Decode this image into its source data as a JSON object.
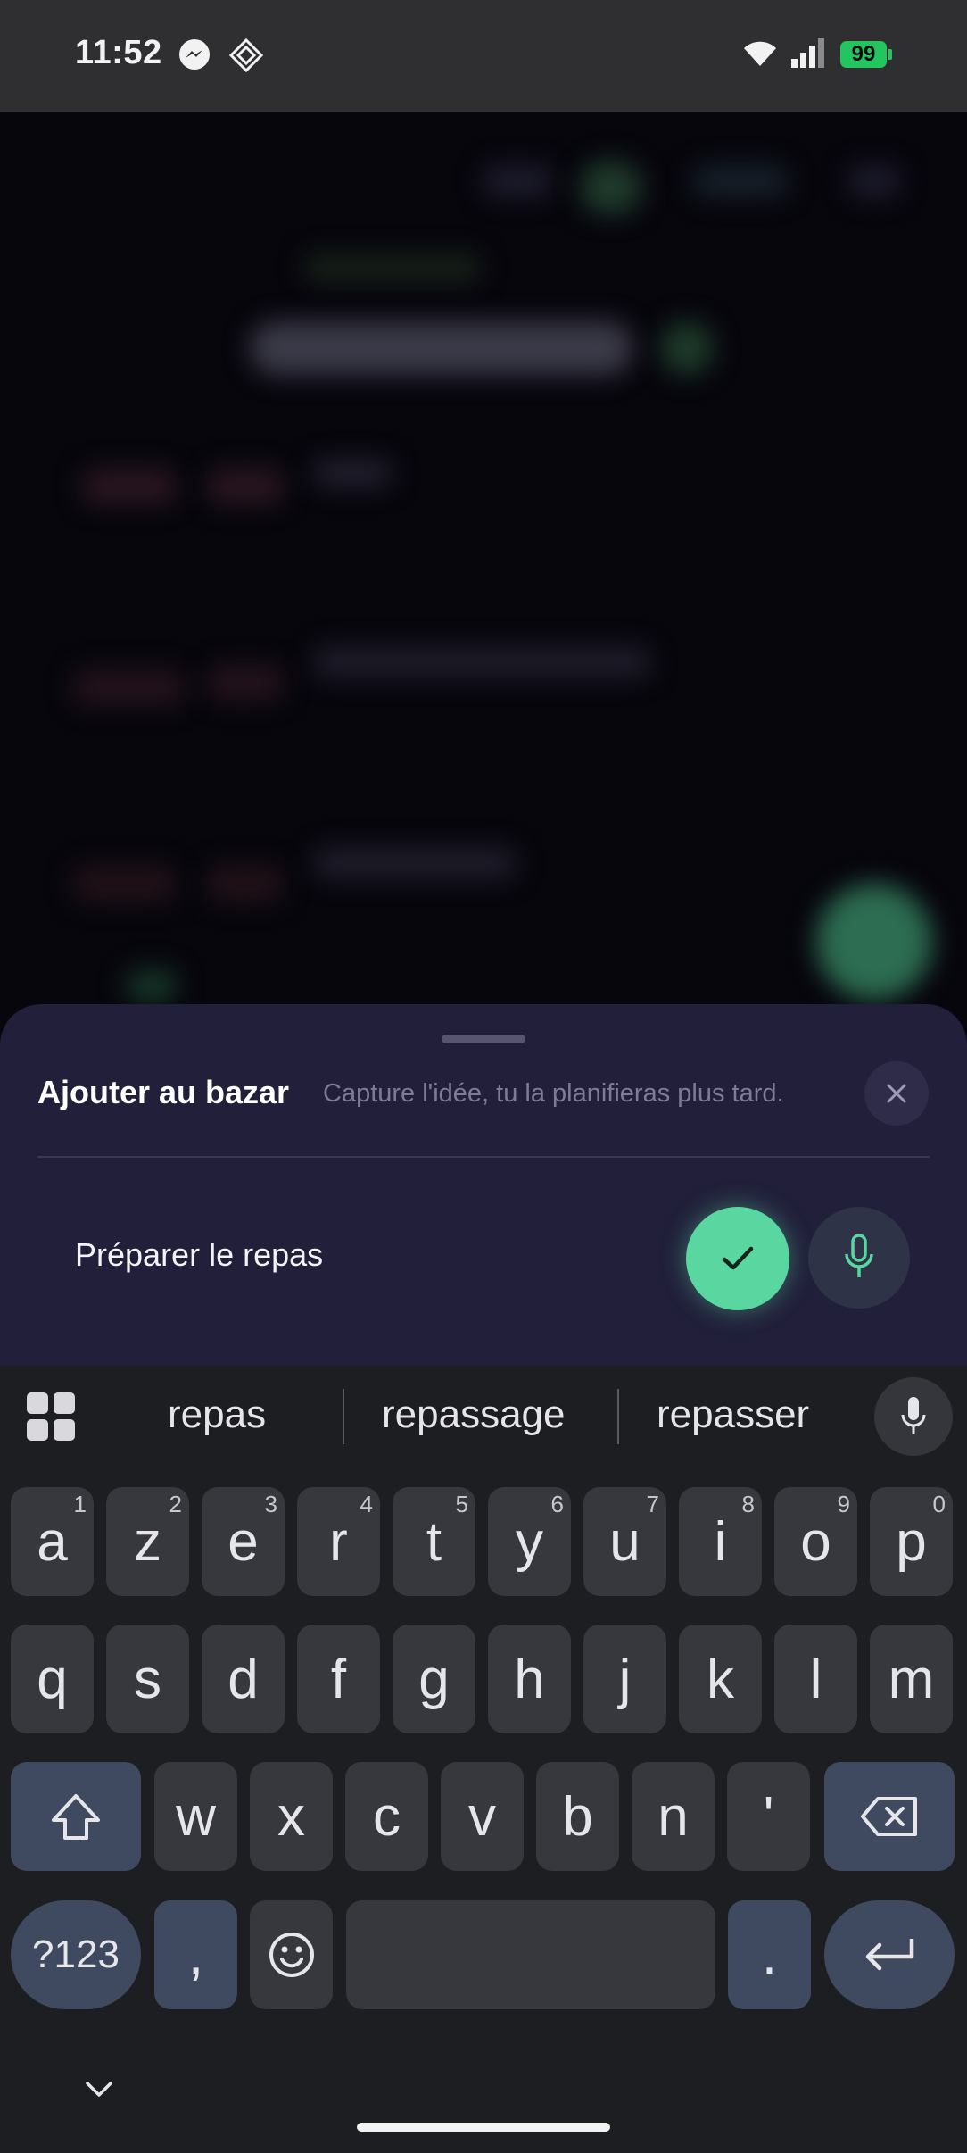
{
  "status_bar": {
    "time": "11:52",
    "battery": "99",
    "icons": [
      "messenger-icon",
      "app-icon",
      "wifi-icon",
      "signal-icon",
      "battery-icon"
    ]
  },
  "sheet": {
    "title": "Ajouter au bazar",
    "subtitle": "Capture l'idée, tu la planifieras plus tard.",
    "input_value": "Préparer le repas",
    "accent_color": "#5ad6a1"
  },
  "keyboard": {
    "suggestions": [
      "repas",
      "repassage",
      "repasser"
    ],
    "row1": [
      {
        "key": "a",
        "hint": "1"
      },
      {
        "key": "z",
        "hint": "2"
      },
      {
        "key": "e",
        "hint": "3"
      },
      {
        "key": "r",
        "hint": "4"
      },
      {
        "key": "t",
        "hint": "5"
      },
      {
        "key": "y",
        "hint": "6"
      },
      {
        "key": "u",
        "hint": "7"
      },
      {
        "key": "i",
        "hint": "8"
      },
      {
        "key": "o",
        "hint": "9"
      },
      {
        "key": "p",
        "hint": "0"
      }
    ],
    "row2": [
      "q",
      "s",
      "d",
      "f",
      "g",
      "h",
      "j",
      "k",
      "l",
      "m"
    ],
    "row3": [
      "w",
      "x",
      "c",
      "v",
      "b",
      "n",
      "'"
    ],
    "symbols_key": "?123",
    "comma_key": ",",
    "period_key": "."
  }
}
